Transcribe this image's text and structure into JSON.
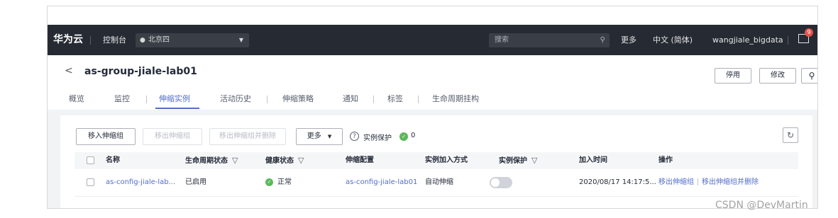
{
  "topbar": {
    "logo": "华为云",
    "console": "控制台",
    "region": "北京四",
    "search_placeholder": "搜索",
    "more": "更多",
    "language": "中文 (简体)",
    "user": "wangjiale_bigdata",
    "mail_badge": "9"
  },
  "header": {
    "title": "as-group-jiale-lab01",
    "disable_button": "停用",
    "modify_button": "修改"
  },
  "tabs": [
    "概览",
    "监控",
    "伸缩实例",
    "活动历史",
    "伸缩策略",
    "通知",
    "标签",
    "生命周期挂构"
  ],
  "active_tab": "伸缩实例",
  "toolbar": {
    "move_in": "移入伸缩组",
    "move_out": "移出伸缩组",
    "move_out_delete": "移出伸缩组并删除",
    "more": "更多",
    "protection_label": "实例保护",
    "protection_count": "0"
  },
  "table": {
    "columns": [
      "名称",
      "生命周期状态",
      "健康状态",
      "伸缩配置",
      "实例加入方式",
      "实例保护",
      "加入时间",
      "操作"
    ],
    "rows": [
      {
        "name": "as-config-jiale-lab...",
        "lifecycle": "已启用",
        "health": "正常",
        "config": "as-config-jiale-lab01",
        "join_method": "自动伸缩",
        "protection_enabled": false,
        "join_time": "2020/08/17 14:17:5...",
        "op_move_out": "移出伸缩组",
        "op_move_out_delete": "移出伸缩组并删除"
      }
    ]
  },
  "watermark": "CSDN @DevMartin",
  "colors": {
    "topbar": "#252a33",
    "accent": "#526ecc",
    "healthy": "#5cb85c"
  }
}
